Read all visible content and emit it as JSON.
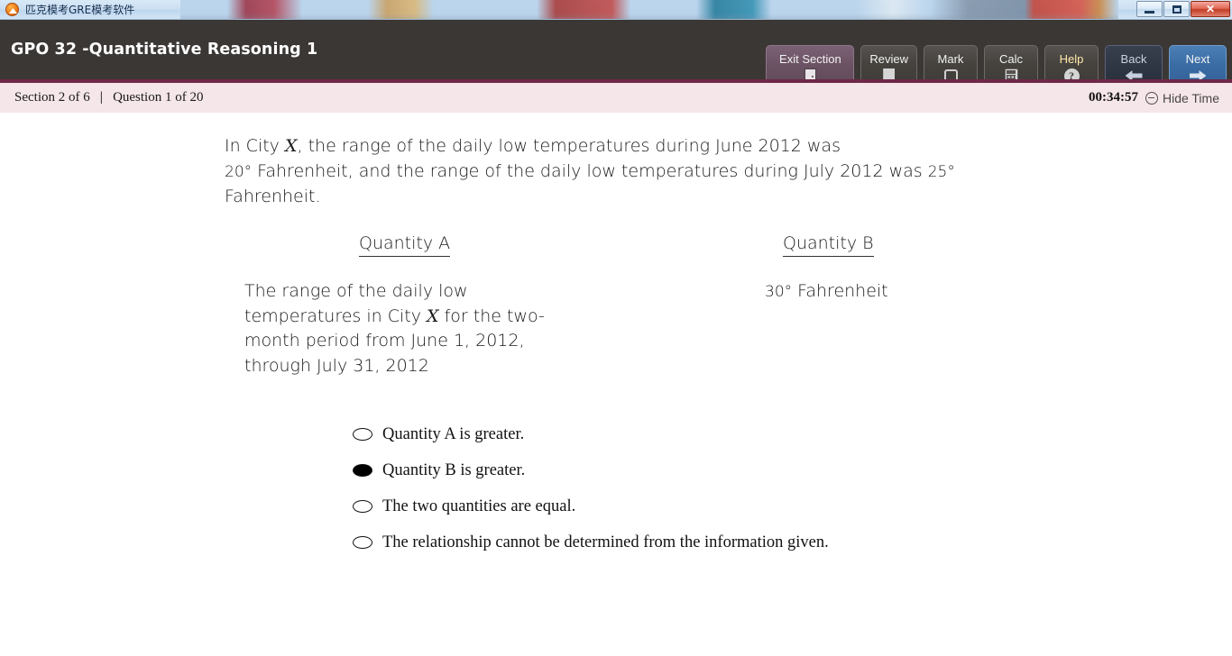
{
  "os_window": {
    "title": "匹克模考GRE模考软件",
    "icon": "app-icon",
    "controls": {
      "minimize": "minimize-icon",
      "maximize": "restore-icon",
      "close": "✕"
    }
  },
  "header": {
    "title": "GPO 32 -Quantitative Reasoning 1",
    "background": "#3b3735",
    "buttons": [
      {
        "label": "Exit Section",
        "icon": "door-icon",
        "style": "exit",
        "accent": "#6a5263"
      },
      {
        "label": "Review",
        "icon": "bookmark-icon",
        "style": "normal"
      },
      {
        "label": "Mark",
        "icon": "checkbox-icon",
        "style": "normal"
      },
      {
        "label": "Calc",
        "icon": "calculator-icon",
        "style": "normal"
      },
      {
        "label": "Help",
        "icon": "question-mark-icon",
        "style": "help"
      },
      {
        "label": "Back",
        "icon": "arrow-left-icon",
        "style": "back",
        "accent": "#2e3543"
      },
      {
        "label": "Next",
        "icon": "arrow-right-icon",
        "style": "next",
        "accent": "#3a6ba3"
      }
    ]
  },
  "status_bar": {
    "section": "Section 2 of 6",
    "separator": "|",
    "question": "Question 1 of 20",
    "timer": "00:34:57",
    "hide_time_label": "Hide Time",
    "hide_time_icon": "minus-circle-icon",
    "background": "#f5e6e9",
    "top_rule_color": "#6e2847"
  },
  "question": {
    "stem_line1_pre": "In City ",
    "stem_var1": "X",
    "stem_line1_post": ", the range of the daily low temperatures during June 2012 was",
    "stem_line2_num1": "20°",
    "stem_line2_mid": " Fahrenheit, and the range of the daily low temperatures during July 2012 was ",
    "stem_line2_num2": "25°",
    "stem_line3": "Fahrenheit.",
    "quantity_a_heading": "Quantity A",
    "quantity_b_heading": "Quantity B",
    "quantity_a_pre": "The range of the daily low temperatures in City ",
    "quantity_a_var": "X",
    "quantity_a_post": " for the two-month period from June 1, 2012, through July 31, 2012",
    "quantity_b_value": "30°",
    "quantity_b_unit": " Fahrenheit",
    "choices": [
      {
        "label": "Quantity A is greater.",
        "selected": false
      },
      {
        "label": "Quantity B is greater.",
        "selected": true
      },
      {
        "label": "The two quantities are equal.",
        "selected": false
      },
      {
        "label": "The relationship cannot be determined from the information given.",
        "selected": false
      }
    ]
  }
}
